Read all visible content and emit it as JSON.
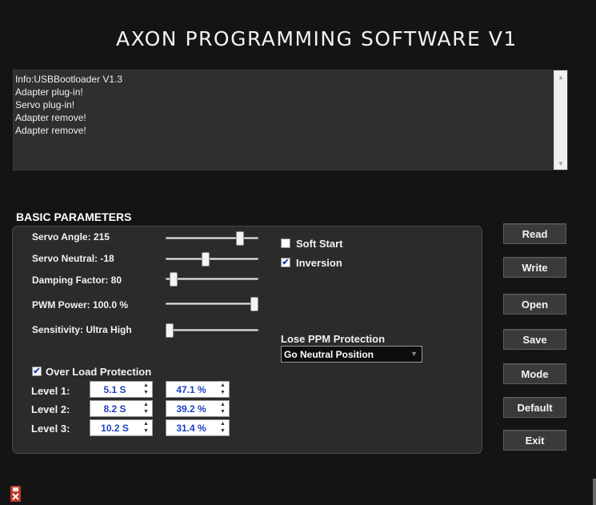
{
  "app": {
    "title": "AXON PROGRAMMING SOFTWARE V1"
  },
  "log": {
    "lines": [
      "Info:USBBootloader V1.3",
      "Adapter plug-in!",
      "Servo plug-in!",
      "Adapter remove!",
      "Adapter remove!"
    ]
  },
  "basic": {
    "title": "BASIC PARAMETERS",
    "params": [
      {
        "label": "Servo Angle: 215",
        "slider": 0.83
      },
      {
        "label": "Servo Neutral: -18",
        "slider": 0.42
      },
      {
        "label": "Damping Factor: 80",
        "slider": 0.05
      },
      {
        "label": "PWM Power: 100.0 %",
        "slider": 1.0
      },
      {
        "label": "Sensitivity: Ultra High",
        "slider": 0.0
      }
    ],
    "soft_start": {
      "label": "Soft Start",
      "checked": false
    },
    "inversion": {
      "label": "Inversion",
      "checked": true
    },
    "lose_ppm": {
      "label": "Lose PPM Protection",
      "value": "Go Neutral Position"
    },
    "over_load": {
      "label": "Over Load Protection",
      "checked": true,
      "levels": [
        {
          "label": "Level 1:",
          "time": "5.1 S",
          "percent": "47.1 %"
        },
        {
          "label": "Level 2:",
          "time": "8.2 S",
          "percent": "39.2 %"
        },
        {
          "label": "Level 3:",
          "time": "10.2 S",
          "percent": "31.4 %"
        }
      ]
    }
  },
  "buttons": {
    "read": "Read",
    "write": "Write",
    "open": "Open",
    "save": "Save",
    "mode": "Mode",
    "default": "Default",
    "exit": "Exit"
  },
  "icons": {
    "check": "✔",
    "spin_up": "▲",
    "spin_down": "▼",
    "dropdown": "▼",
    "scroll_up": "▲",
    "scroll_down": "▼"
  },
  "colors": {
    "background": "#141414",
    "panel": "#2b2b2b",
    "spin_text": "#1d3fc4",
    "usb_icon": "#c0392b"
  }
}
